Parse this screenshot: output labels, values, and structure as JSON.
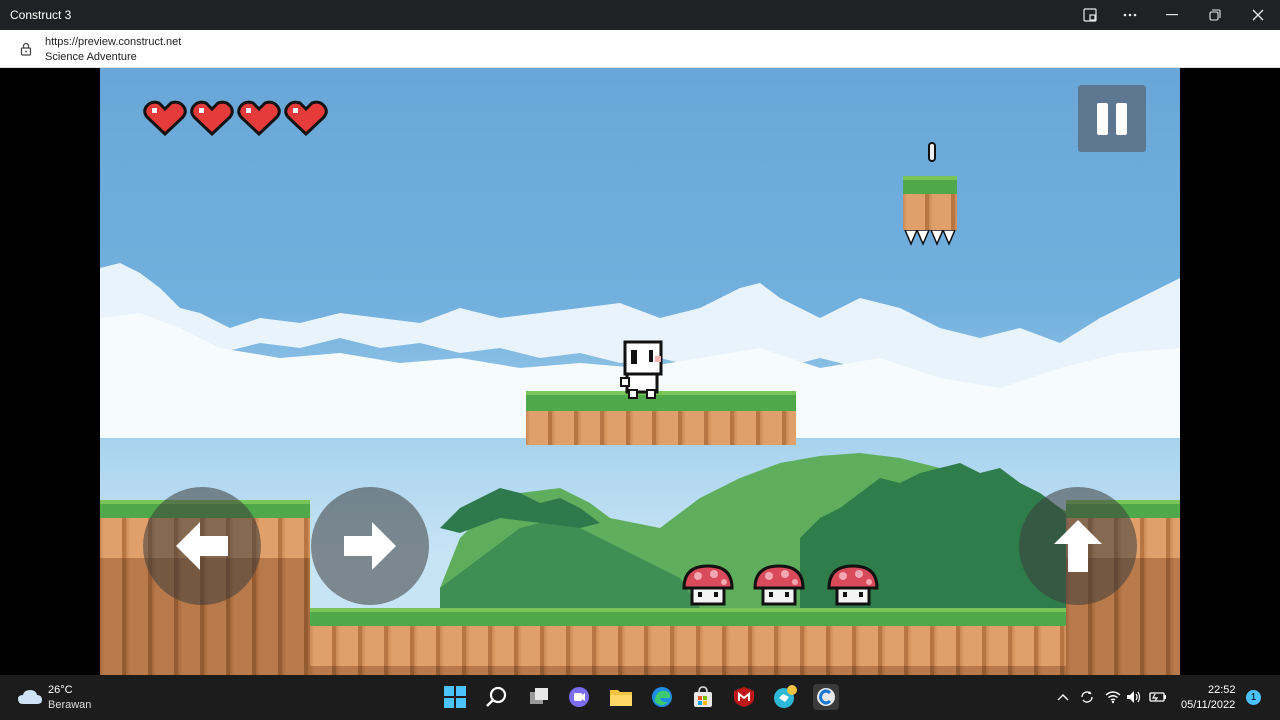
{
  "window": {
    "title": "Construct 3",
    "buttons": [
      "cast-icon",
      "more-icon",
      "minimize-icon",
      "restore-icon",
      "close-icon"
    ]
  },
  "address": {
    "url": "https://preview.construct.net",
    "page_title": "Science Adventure"
  },
  "game": {
    "hearts": 4,
    "controls": [
      "left",
      "right",
      "jump",
      "pause"
    ]
  },
  "taskbar": {
    "weather_temp": "26°C",
    "weather_desc": "Berawan",
    "time": "22:52",
    "date": "05/11/2022",
    "notifications": "1"
  },
  "colors": {
    "sky": "#6aa8d8",
    "grass": "#4fa84a",
    "dirt": "#e0a06b",
    "heart": "#e53b3b"
  }
}
